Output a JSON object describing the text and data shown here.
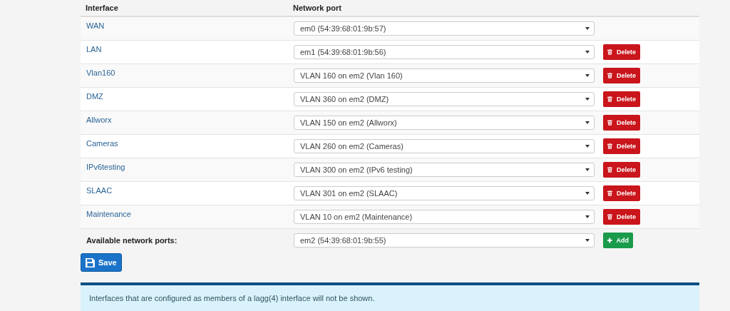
{
  "table": {
    "columns": [
      "Interface",
      "Network port"
    ],
    "rows": [
      {
        "interface": "WAN",
        "port": "em0 (54:39:68:01:9b:57)"
      },
      {
        "interface": "LAN",
        "port": "em1 (54:39:68:01:9b:56)",
        "button": "Delete"
      },
      {
        "interface": "Vlan160",
        "port": "VLAN 160 on em2 (Vlan 160)",
        "button": "Delete"
      },
      {
        "interface": "DMZ",
        "port": "VLAN 360 on em2 (DMZ)",
        "button": "Delete"
      },
      {
        "interface": "Allworx",
        "port": "VLAN 150 on em2 (Allworx)",
        "button": "Delete"
      },
      {
        "interface": "Cameras",
        "port": "VLAN 260 on em2 (Cameras)",
        "button": "Delete"
      },
      {
        "interface": "IPv6testing",
        "port": "VLAN 300 on em2 (IPv6 testing)",
        "button": "Delete"
      },
      {
        "interface": "SLAAC",
        "port": "VLAN 301 on em2 (SLAAC)",
        "button": "Delete"
      },
      {
        "interface": "Maintenance",
        "port": "VLAN 10 on em2 (Maintenance)",
        "button": "Delete"
      }
    ],
    "available": {
      "label": "Available network ports:",
      "port": "em2 (54:39:68:01:9b:55)",
      "button": "Add"
    }
  },
  "save_button": "Save",
  "info": "Interfaces that are configured as members of a lagg(4) interface will not be shown."
}
